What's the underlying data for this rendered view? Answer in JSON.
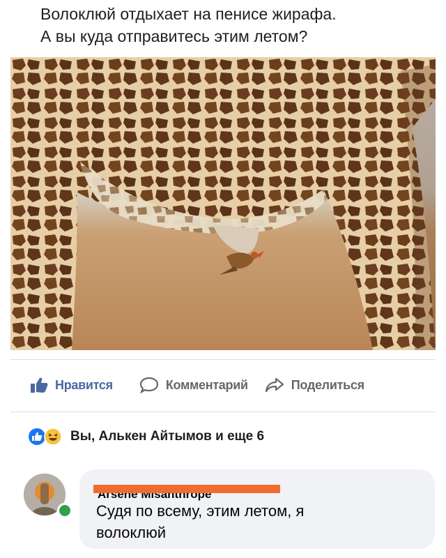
{
  "post": {
    "text_lines": [
      "Волоклюй отдыхает на пенисе жирафа.",
      "А вы куда отправитесь этим летом?"
    ],
    "photo_icon": "giraffe-with-oxpecker-photo"
  },
  "actions": {
    "like_label": "Нравится",
    "comment_label": "Комментарий",
    "share_label": "Поделиться"
  },
  "reactions": {
    "text": "Вы, Алькен Айтымов и еще 6",
    "icons": [
      "like-icon",
      "haha-icon"
    ]
  },
  "comment": {
    "author_obscured": "Arsene Misanthrope",
    "text_lines": [
      "Судя по всему, этим летом, я",
      "волоклюй"
    ],
    "online": true
  },
  "colors": {
    "like_blue": "#4b67a1",
    "online_green": "#31a24c",
    "redaction_orange": "#f26b2e"
  }
}
